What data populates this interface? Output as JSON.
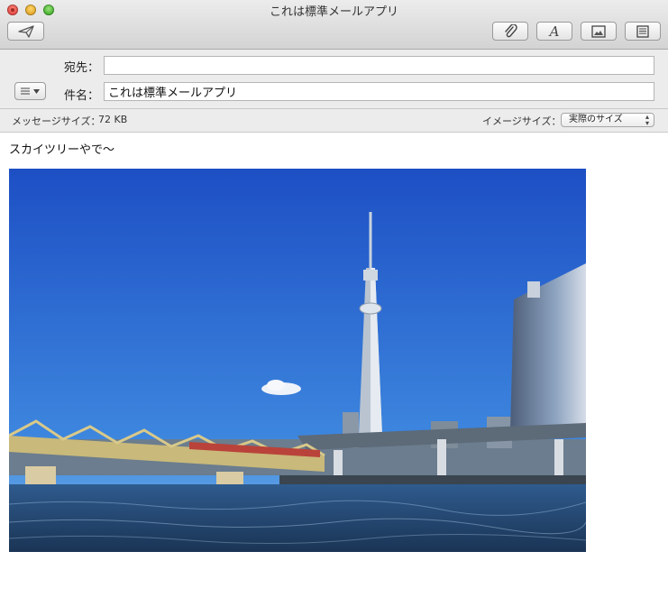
{
  "window": {
    "title": "これは標準メールアプリ"
  },
  "toolbar": {
    "send_icon": "send-icon",
    "attach_icon": "paperclip-icon",
    "font_icon": "font-icon",
    "photo_icon": "photo-browser-icon",
    "template_icon": "stationery-icon"
  },
  "header": {
    "to_label": "宛先：",
    "to_value": "",
    "subject_label": "件名：",
    "subject_value": "これは標準メールアプリ",
    "menu_icon": "list-icon"
  },
  "infobar": {
    "message_size_label": "メッセージサイズ：",
    "message_size_value": "72 KB",
    "image_size_label": "イメージサイズ：",
    "image_size_value": "実際のサイズ"
  },
  "body": {
    "text": "スカイツリーやで〜"
  },
  "colors": {
    "sky_top": "#1f56c8",
    "sky_bottom": "#5da6e6",
    "water": "#23436a",
    "close": "#e0443e",
    "minimize": "#e0a325",
    "zoom": "#3fae2b"
  }
}
